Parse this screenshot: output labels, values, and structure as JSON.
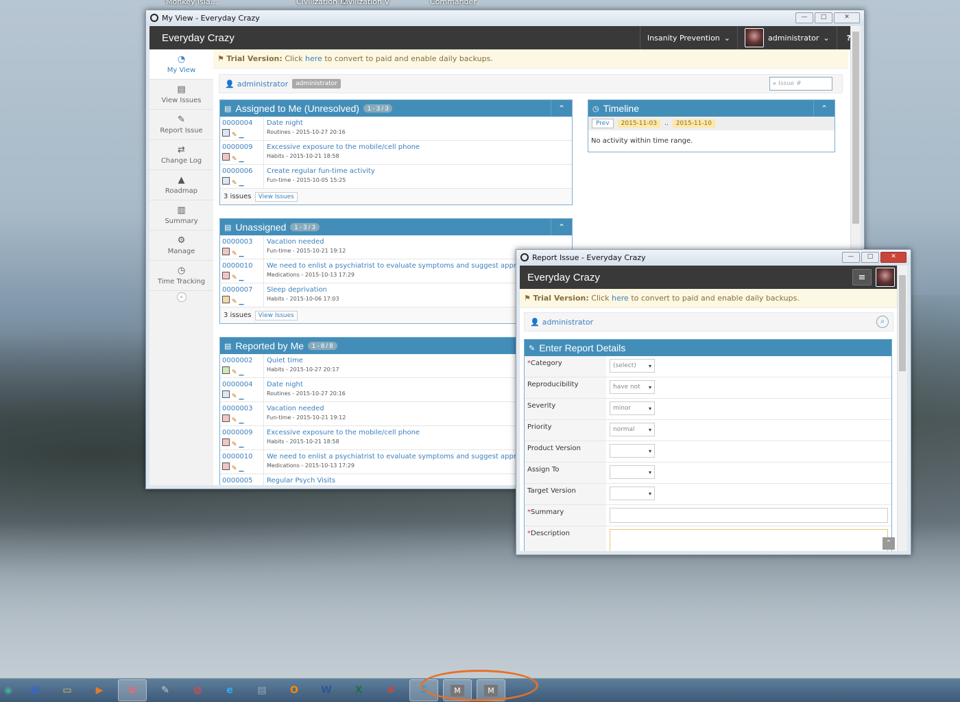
{
  "desktop": {
    "top_labels": [
      "Monkey Isla...",
      "Civilization IV",
      "Civilization V",
      "Commander"
    ]
  },
  "main_window": {
    "title": "My View - Everyday Crazy",
    "brand": "Everyday Crazy",
    "project_selector": "Insanity Prevention",
    "user_menu": "administrator",
    "help": "?",
    "trial": {
      "label": "Trial Version:",
      "pre": "Click",
      "link": "here",
      "post": "to convert to paid and enable daily backups."
    },
    "breadcrumb": {
      "user": "administrator",
      "badge": "administrator",
      "search_placeholder": "Issue #"
    },
    "sidebar": [
      {
        "label": "My View",
        "icon": "tachometer-icon"
      },
      {
        "label": "View Issues",
        "icon": "list-icon"
      },
      {
        "label": "Report Issue",
        "icon": "edit-icon"
      },
      {
        "label": "Change Log",
        "icon": "retweet-icon"
      },
      {
        "label": "Roadmap",
        "icon": "road-icon"
      },
      {
        "label": "Summary",
        "icon": "bar-chart-icon"
      },
      {
        "label": "Manage",
        "icon": "gears-icon"
      },
      {
        "label": "Time Tracking",
        "icon": "clock-icon"
      }
    ],
    "assigned": {
      "title": "Assigned to Me (Unresolved)",
      "count": "1 - 3 / 3",
      "rows": [
        {
          "id": "0000004",
          "title": "Date night",
          "meta": "Routines - 2015-10-27 20:16",
          "color": "#dbe6f6"
        },
        {
          "id": "0000009",
          "title": "Excessive exposure to the mobile/cell phone",
          "meta": "Habits - 2015-10-21 18:58",
          "color": "#f3c4c4"
        },
        {
          "id": "0000006",
          "title": "Create regular fun-time activity",
          "meta": "Fun-time - 2015-10-05 15:25",
          "color": "#dbe6f6"
        }
      ],
      "footer_count": "3 issues",
      "footer_btn": "View Issues"
    },
    "unassigned": {
      "title": "Unassigned",
      "count": "1 - 3 / 3",
      "rows": [
        {
          "id": "0000003",
          "title": "Vacation needed",
          "meta": "Fun-time - 2015-10-21 19:12",
          "color": "#f3c4c4"
        },
        {
          "id": "0000010",
          "title": "We need to enlist a psychiatrist to evaluate symptoms and suggest appropriat",
          "meta": "Medications - 2015-10-13 17:29",
          "color": "#f3c4c4"
        },
        {
          "id": "0000007",
          "title": "Sleep deprivation",
          "meta": "Habits - 2015-10-06 17:03",
          "color": "#f8d8a8"
        }
      ],
      "footer_count": "3 issues",
      "footer_btn": "View Issues"
    },
    "reported": {
      "title": "Reported by Me",
      "count": "1 - 8 / 8",
      "rows": [
        {
          "id": "0000002",
          "title": "Quiet time",
          "meta": "Habits - 2015-10-27 20:17",
          "color": "#cfe8b8"
        },
        {
          "id": "0000004",
          "title": "Date night",
          "meta": "Routines - 2015-10-27 20:16",
          "color": "#dbe6f6"
        },
        {
          "id": "0000003",
          "title": "Vacation needed",
          "meta": "Fun-time - 2015-10-21 19:12",
          "color": "#f3c4c4"
        },
        {
          "id": "0000009",
          "title": "Excessive exposure to the mobile/cell phone",
          "meta": "Habits - 2015-10-21 18:58",
          "color": "#f3c4c4"
        },
        {
          "id": "0000010",
          "title": "We need to enlist a psychiatrist to evaluate symptoms and suggest appropriat",
          "meta": "Medications - 2015-10-13 17:29",
          "color": "#f3c4c4"
        },
        {
          "id": "0000005",
          "title": "Regular Psych Visits",
          "meta": "",
          "color": "#dbe6f6"
        }
      ]
    },
    "timeline": {
      "title": "Timeline",
      "prev": "Prev",
      "from": "2015-11-03",
      "sep": "..",
      "to": "2015-11-10",
      "empty": "No activity within time range."
    }
  },
  "report_window": {
    "title": "Report Issue - Everyday Crazy",
    "brand": "Everyday Crazy",
    "trial": {
      "label": "Trial Version:",
      "pre": "Click",
      "link": "here",
      "post": "to convert to paid and enable daily backups."
    },
    "user": "administrator",
    "section_title": "Enter Report Details",
    "fields": [
      {
        "label": "Category",
        "required": true,
        "type": "select",
        "value": "(select)"
      },
      {
        "label": "Reproducibility",
        "required": false,
        "type": "select",
        "value": "have not"
      },
      {
        "label": "Severity",
        "required": false,
        "type": "select",
        "value": "minor"
      },
      {
        "label": "Priority",
        "required": false,
        "type": "select",
        "value": "normal"
      },
      {
        "label": "Product Version",
        "required": false,
        "type": "select",
        "value": ""
      },
      {
        "label": "Assign To",
        "required": false,
        "type": "select",
        "value": ""
      },
      {
        "label": "Target Version",
        "required": false,
        "type": "select",
        "value": ""
      },
      {
        "label": "Summary",
        "required": true,
        "type": "text",
        "value": ""
      },
      {
        "label": "Description",
        "required": true,
        "type": "textarea",
        "value": ""
      }
    ]
  },
  "taskbar": {
    "items": [
      "start-orb-icon",
      "library-icon",
      "folder-icon",
      "media-player-icon",
      "paint-icon",
      "tools-icon",
      "chrome-icon",
      "ie-icon",
      "calculator-icon",
      "outlook-icon",
      "word-icon",
      "excel-icon",
      "games-icon",
      "skype-icon",
      "app-m-icon",
      "app-m-icon"
    ],
    "m_label": "M"
  }
}
